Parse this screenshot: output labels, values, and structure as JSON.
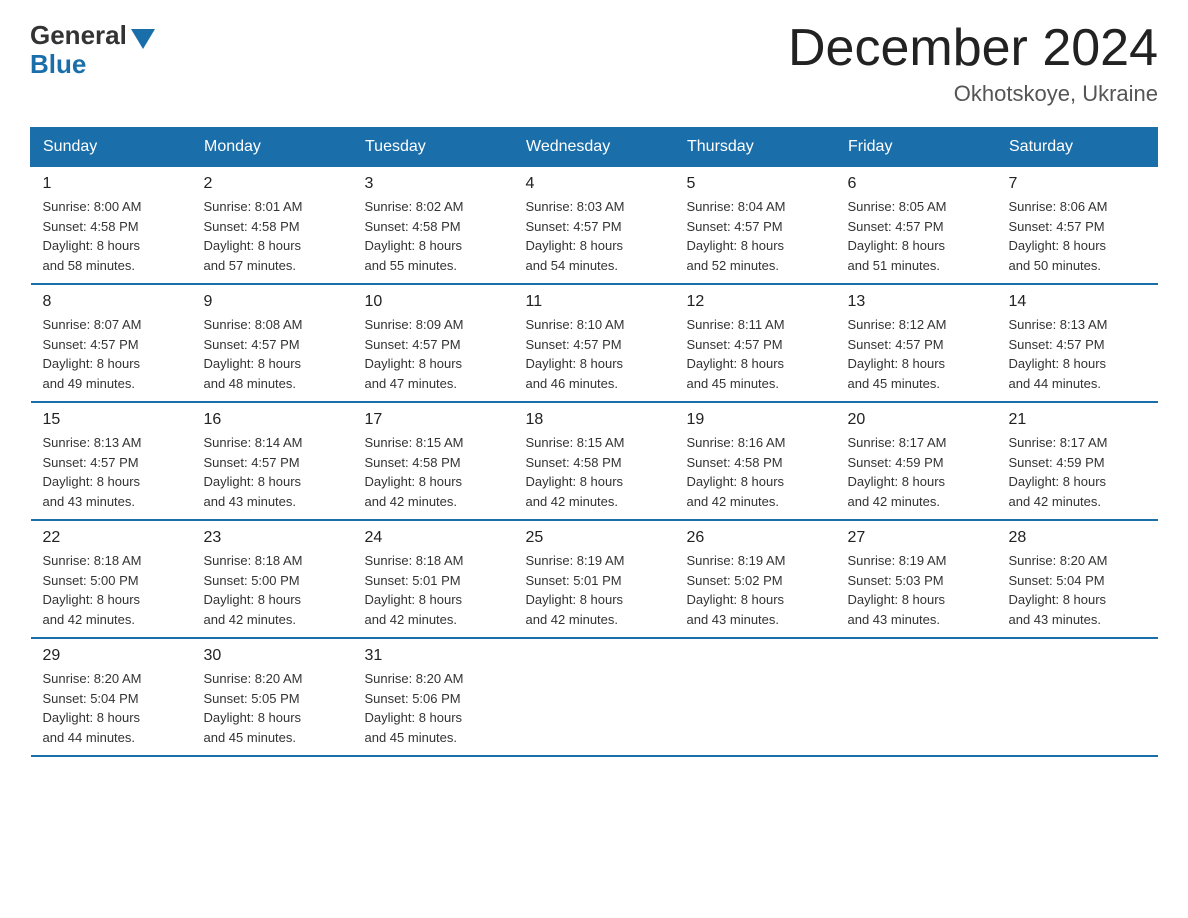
{
  "header": {
    "logo_general": "General",
    "logo_blue": "Blue",
    "month_title": "December 2024",
    "location": "Okhotskoye, Ukraine"
  },
  "weekdays": [
    "Sunday",
    "Monday",
    "Tuesday",
    "Wednesday",
    "Thursday",
    "Friday",
    "Saturday"
  ],
  "weeks": [
    [
      {
        "day": "1",
        "sunrise": "8:00 AM",
        "sunset": "4:58 PM",
        "daylight": "8 hours and 58 minutes."
      },
      {
        "day": "2",
        "sunrise": "8:01 AM",
        "sunset": "4:58 PM",
        "daylight": "8 hours and 57 minutes."
      },
      {
        "day": "3",
        "sunrise": "8:02 AM",
        "sunset": "4:58 PM",
        "daylight": "8 hours and 55 minutes."
      },
      {
        "day": "4",
        "sunrise": "8:03 AM",
        "sunset": "4:57 PM",
        "daylight": "8 hours and 54 minutes."
      },
      {
        "day": "5",
        "sunrise": "8:04 AM",
        "sunset": "4:57 PM",
        "daylight": "8 hours and 52 minutes."
      },
      {
        "day": "6",
        "sunrise": "8:05 AM",
        "sunset": "4:57 PM",
        "daylight": "8 hours and 51 minutes."
      },
      {
        "day": "7",
        "sunrise": "8:06 AM",
        "sunset": "4:57 PM",
        "daylight": "8 hours and 50 minutes."
      }
    ],
    [
      {
        "day": "8",
        "sunrise": "8:07 AM",
        "sunset": "4:57 PM",
        "daylight": "8 hours and 49 minutes."
      },
      {
        "day": "9",
        "sunrise": "8:08 AM",
        "sunset": "4:57 PM",
        "daylight": "8 hours and 48 minutes."
      },
      {
        "day": "10",
        "sunrise": "8:09 AM",
        "sunset": "4:57 PM",
        "daylight": "8 hours and 47 minutes."
      },
      {
        "day": "11",
        "sunrise": "8:10 AM",
        "sunset": "4:57 PM",
        "daylight": "8 hours and 46 minutes."
      },
      {
        "day": "12",
        "sunrise": "8:11 AM",
        "sunset": "4:57 PM",
        "daylight": "8 hours and 45 minutes."
      },
      {
        "day": "13",
        "sunrise": "8:12 AM",
        "sunset": "4:57 PM",
        "daylight": "8 hours and 45 minutes."
      },
      {
        "day": "14",
        "sunrise": "8:13 AM",
        "sunset": "4:57 PM",
        "daylight": "8 hours and 44 minutes."
      }
    ],
    [
      {
        "day": "15",
        "sunrise": "8:13 AM",
        "sunset": "4:57 PM",
        "daylight": "8 hours and 43 minutes."
      },
      {
        "day": "16",
        "sunrise": "8:14 AM",
        "sunset": "4:57 PM",
        "daylight": "8 hours and 43 minutes."
      },
      {
        "day": "17",
        "sunrise": "8:15 AM",
        "sunset": "4:58 PM",
        "daylight": "8 hours and 42 minutes."
      },
      {
        "day": "18",
        "sunrise": "8:15 AM",
        "sunset": "4:58 PM",
        "daylight": "8 hours and 42 minutes."
      },
      {
        "day": "19",
        "sunrise": "8:16 AM",
        "sunset": "4:58 PM",
        "daylight": "8 hours and 42 minutes."
      },
      {
        "day": "20",
        "sunrise": "8:17 AM",
        "sunset": "4:59 PM",
        "daylight": "8 hours and 42 minutes."
      },
      {
        "day": "21",
        "sunrise": "8:17 AM",
        "sunset": "4:59 PM",
        "daylight": "8 hours and 42 minutes."
      }
    ],
    [
      {
        "day": "22",
        "sunrise": "8:18 AM",
        "sunset": "5:00 PM",
        "daylight": "8 hours and 42 minutes."
      },
      {
        "day": "23",
        "sunrise": "8:18 AM",
        "sunset": "5:00 PM",
        "daylight": "8 hours and 42 minutes."
      },
      {
        "day": "24",
        "sunrise": "8:18 AM",
        "sunset": "5:01 PM",
        "daylight": "8 hours and 42 minutes."
      },
      {
        "day": "25",
        "sunrise": "8:19 AM",
        "sunset": "5:01 PM",
        "daylight": "8 hours and 42 minutes."
      },
      {
        "day": "26",
        "sunrise": "8:19 AM",
        "sunset": "5:02 PM",
        "daylight": "8 hours and 43 minutes."
      },
      {
        "day": "27",
        "sunrise": "8:19 AM",
        "sunset": "5:03 PM",
        "daylight": "8 hours and 43 minutes."
      },
      {
        "day": "28",
        "sunrise": "8:20 AM",
        "sunset": "5:04 PM",
        "daylight": "8 hours and 43 minutes."
      }
    ],
    [
      {
        "day": "29",
        "sunrise": "8:20 AM",
        "sunset": "5:04 PM",
        "daylight": "8 hours and 44 minutes."
      },
      {
        "day": "30",
        "sunrise": "8:20 AM",
        "sunset": "5:05 PM",
        "daylight": "8 hours and 45 minutes."
      },
      {
        "day": "31",
        "sunrise": "8:20 AM",
        "sunset": "5:06 PM",
        "daylight": "8 hours and 45 minutes."
      },
      null,
      null,
      null,
      null
    ]
  ],
  "labels": {
    "sunrise": "Sunrise:",
    "sunset": "Sunset:",
    "daylight": "Daylight:"
  }
}
